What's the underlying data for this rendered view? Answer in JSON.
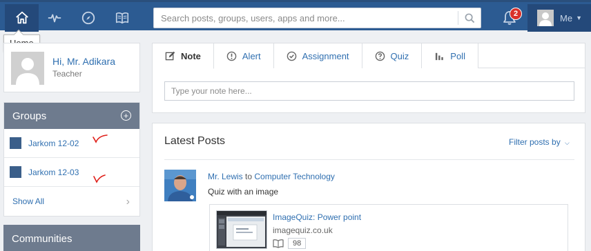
{
  "nav": {
    "home_tooltip": "Home",
    "search_placeholder": "Search posts, groups, users, apps and more...",
    "notification_count": "2",
    "me_label": "Me"
  },
  "profile": {
    "greeting": "Hi, Mr. Adikara",
    "role": "Teacher"
  },
  "groups": {
    "title": "Groups",
    "items": [
      {
        "name": "Jarkom 12-02"
      },
      {
        "name": "Jarkom 12-03"
      }
    ],
    "show_all": "Show All"
  },
  "communities": {
    "title": "Communities"
  },
  "composer": {
    "tabs": [
      {
        "label": "Note",
        "icon": "edit-icon"
      },
      {
        "label": "Alert",
        "icon": "alert-icon"
      },
      {
        "label": "Assignment",
        "icon": "check-circle-icon"
      },
      {
        "label": "Quiz",
        "icon": "question-icon"
      },
      {
        "label": "Poll",
        "icon": "bar-chart-icon"
      }
    ],
    "note_placeholder": "Type your note here..."
  },
  "posts": {
    "title": "Latest Posts",
    "filter_label": "Filter posts by",
    "items": [
      {
        "author": "Mr. Lewis",
        "to_word": "to",
        "target": "Computer Technology",
        "text": "Quiz with an image",
        "attachment": {
          "title": "ImageQuiz: Power point",
          "domain": "imagequiz.co.uk",
          "count": "98"
        }
      }
    ]
  },
  "colors": {
    "topbar": "#2c5b92",
    "link": "#2f6fb0",
    "panel_head": "#6e7b8e",
    "badge": "#d9302a",
    "annotation_check": "#e0201a"
  }
}
